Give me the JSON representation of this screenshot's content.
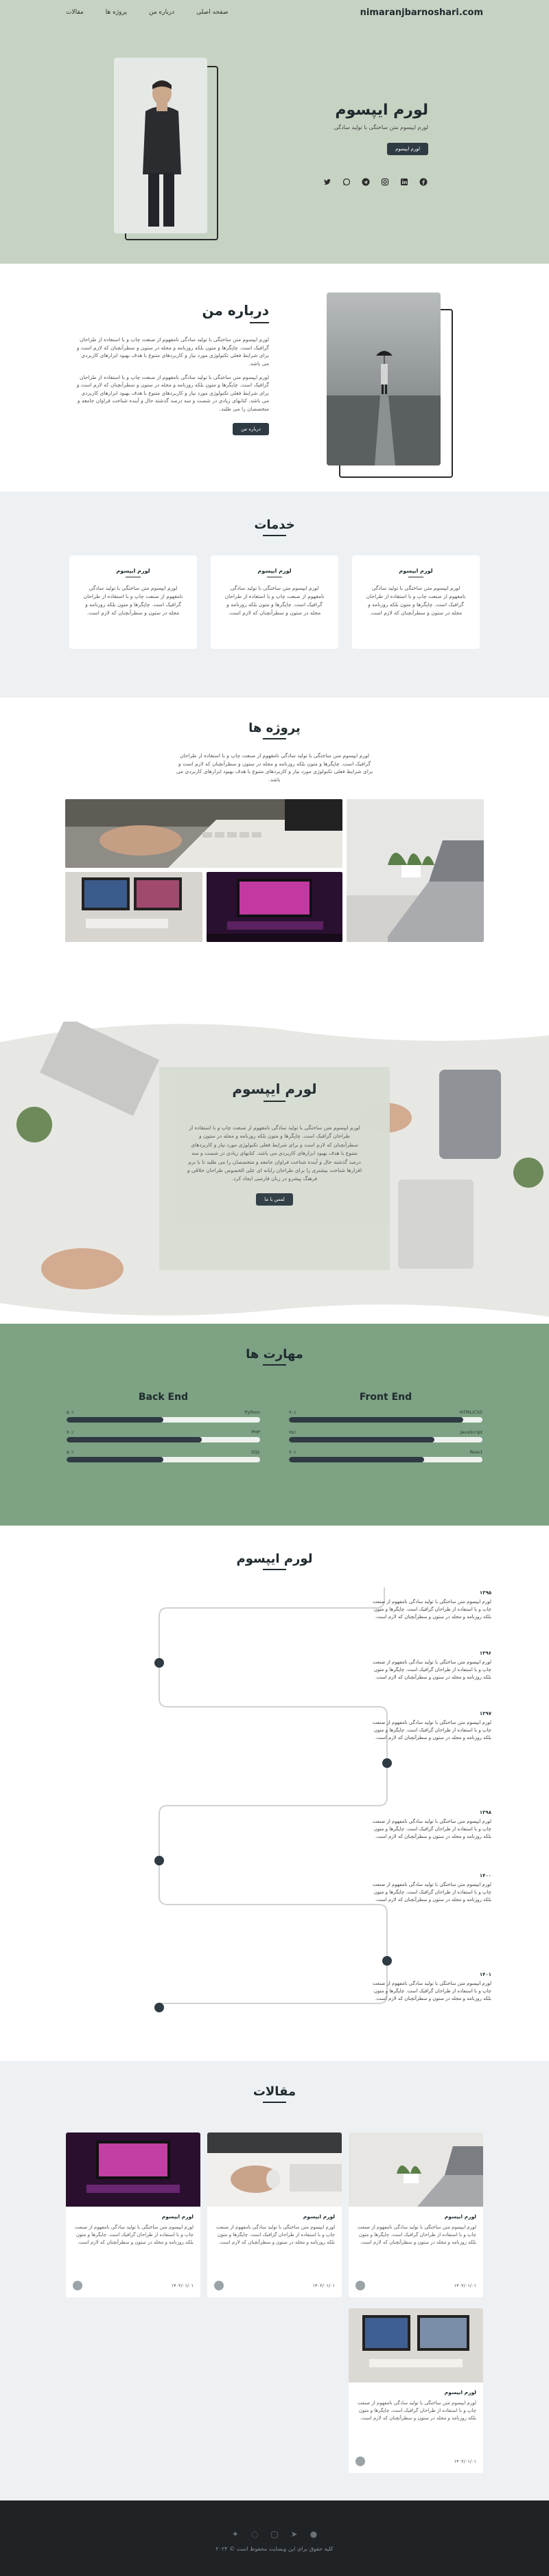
{
  "nav": {
    "brand": "nimaranjbarnoshari.com",
    "links": [
      "صفحه اصلی",
      "درباره من",
      "پروژه ها",
      "مقالات"
    ]
  },
  "hero": {
    "title": "لورم ایپسوم",
    "subtitle": "لورم ایپسوم متن ساختگی با تولید سادگی",
    "button": "لورم ایپسوم",
    "social_icons": [
      "twitter-icon",
      "whatsapp-icon",
      "telegram-icon",
      "instagram-icon",
      "linkedin-icon",
      "facebook-icon"
    ]
  },
  "about": {
    "title": "درباره من",
    "p1": "لورم ایپسوم متن ساختگی با تولید سادگی نامفهوم از صنعت چاپ و با استفاده از طراحان گرافیک است. چاپگرها و متون بلکه روزنامه و مجله در ستون و سطرآنچنان که لازم است و برای شرایط فعلی تکنولوژی مورد نیاز و کاربردهای متنوع با هدف بهبود ابزارهای کاربردی می باشد.",
    "p2": "لورم ایپسوم متن ساختگی با تولید سادگی نامفهوم از صنعت چاپ و با استفاده از طراحان گرافیک است. چاپگرها و متون بلکه روزنامه و مجله در ستون و سطرآنچنان که لازم است و برای شرایط فعلی تکنولوژی مورد نیاز و کاربردهای متنوع با هدف بهبود ابزارهای کاربردی می باشد. کتابهای زیادی در شصت و سه درصد گذشته حال و آینده شناخت فراوان جامعه و متخصصان را می طلبد.",
    "button": "درباره من"
  },
  "services": {
    "title": "خدمات",
    "cards": [
      {
        "title": "لورم ایپسوم",
        "text": "لورم ایپسوم متن ساختگی با تولید سادگی نامفهوم از صنعت چاپ و با استفاده از طراحان گرافیک است. چاپگرها و متون بلکه روزنامه و مجله در ستون و سطرآنچنان که لازم است."
      },
      {
        "title": "لورم ایپسوم",
        "text": "لورم ایپسوم متن ساختگی با تولید سادگی نامفهوم از صنعت چاپ و با استفاده از طراحان گرافیک است. چاپگرها و متون بلکه روزنامه و مجله در ستون و سطرآنچنان که لازم است."
      },
      {
        "title": "لورم ایپسوم",
        "text": "لورم ایپسوم متن ساختگی با تولید سادگی نامفهوم از صنعت چاپ و با استفاده از طراحان گرافیک است. چاپگرها و متون بلکه روزنامه و مجله در ستون و سطرآنچنان که لازم است."
      }
    ]
  },
  "projects": {
    "title": "پروژه ها",
    "desc": "لورم ایپسوم متن ساختگی با تولید سادگی نامفهوم از صنعت چاپ و با استفاده از طراحان گرافیک است. چاپگرها و متون بلکه روزنامه و مجله در ستون و سطرآنچنان که لازم است و برای شرایط فعلی تکنولوژی مورد نیاز و کاربردهای متنوع با هدف بهبود ابزارهای کاربردی می باشد."
  },
  "feature": {
    "title": "لورم ایپسوم",
    "text": "لورم ایپسوم متن ساختگی با تولید سادگی نامفهوم از صنعت چاپ و با استفاده از طراحان گرافیک است. چاپگرها و متون بلکه روزنامه و مجله در ستون و سطرآنچنان که لازم است و برای شرایط فعلی تکنولوژی مورد نیاز و کاربردهای متنوع با هدف بهبود ابزارهای کاربردی می باشد. کتابهای زیادی در شصت و سه درصد گذشته حال و آینده شناخت فراوان جامعه و متخصصان را می طلبد تا با نرم افزارها شناخت بیشتری را برای طراحان رایانه ای علی الخصوص طراحان خلاقی و فرهنگ پیشرو در زبان فارسی ایجاد کرد.",
    "button": "لمس با ما"
  },
  "skills": {
    "title": "مهارت ها",
    "columns": [
      {
        "heading": "Front End",
        "rows": [
          {
            "name": "HTML/CSS",
            "pct_label": "۹۰٪",
            "value": 90
          },
          {
            "name": "JavaScript",
            "pct_label": "۷۵٪",
            "value": 75
          },
          {
            "name": "React",
            "pct_label": "۷۰٪",
            "value": 70
          }
        ]
      },
      {
        "heading": "Back End",
        "rows": [
          {
            "name": "Python",
            "pct_label": "۵۰٪",
            "value": 50
          },
          {
            "name": "PHP",
            "pct_label": "۷۰٪",
            "value": 70
          },
          {
            "name": "SQL",
            "pct_label": "۵۰٪",
            "value": 50
          }
        ]
      }
    ]
  },
  "timeline": {
    "title": "لورم ایپسوم",
    "items": [
      {
        "year": "۱۳۹۵",
        "text": "لورم ایپسوم متن ساختگی با تولید سادگی نامفهوم از صنعت چاپ و با استفاده از طراحان گرافیک است. چاپگرها و متون بلکه روزنامه و مجله در ستون و سطرآنچنان که لازم است."
      },
      {
        "year": "۱۳۹۶",
        "text": "لورم ایپسوم متن ساختگی با تولید سادگی نامفهوم از صنعت چاپ و با استفاده از طراحان گرافیک است. چاپگرها و متون بلکه روزنامه و مجله در ستون و سطرآنچنان که لازم است."
      },
      {
        "year": "۱۳۹۷",
        "text": "لورم ایپسوم متن ساختگی با تولید سادگی نامفهوم از صنعت چاپ و با استفاده از طراحان گرافیک است. چاپگرها و متون بلکه روزنامه و مجله در ستون و سطرآنچنان که لازم است."
      },
      {
        "year": "۱۳۹۸",
        "text": "لورم ایپسوم متن ساختگی با تولید سادگی نامفهوم از صنعت چاپ و با استفاده از طراحان گرافیک است. چاپگرها و متون بلکه روزنامه و مجله در ستون و سطرآنچنان که لازم است."
      },
      {
        "year": "۱۴۰۰",
        "text": "لورم ایپسوم متن ساختگی با تولید سادگی نامفهوم از صنعت چاپ و با استفاده از طراحان گرافیک است. چاپگرها و متون بلکه روزنامه و مجله در ستون و سطرآنچنان که لازم است."
      },
      {
        "year": "۱۴۰۱",
        "text": "لورم ایپسوم متن ساختگی با تولید سادگی نامفهوم از صنعت چاپ و با استفاده از طراحان گرافیک است. چاپگرها و متون بلکه روزنامه و مجله در ستون و سطرآنچنان که لازم است."
      }
    ]
  },
  "articles": {
    "title": "مقالات",
    "items": [
      {
        "title": "لورم ایپسوم",
        "text": "لورم ایپسوم متن ساختگی با تولید سادگی نامفهوم از صنعت چاپ و با استفاده از طراحان گرافیک است. چاپگرها و متون بلکه روزنامه و مجله در ستون و سطرآنچنان که لازم است.",
        "date": "۱۴۰۲/۰۱/۰۱",
        "image": "desk-laptop-plant"
      },
      {
        "title": "لورم ایپسوم",
        "text": "لورم ایپسوم متن ساختگی با تولید سادگی نامفهوم از صنعت چاپ و با استفاده از طراحان گرافیک است. چاپگرها و متون بلکه روزنامه و مجله در ستون و سطرآنچنان که لازم است.",
        "date": "۱۴۰۲/۰۱/۰۱",
        "image": "hand-mouse"
      },
      {
        "title": "لورم ایپسوم",
        "text": "لورم ایپسوم متن ساختگی با تولید سادگی نامفهوم از صنعت چاپ و با استفاده از طراحان گرافیک است. چاپگرها و متون بلکه روزنامه و مجله در ستون و سطرآنچنان که لازم است.",
        "date": "۱۴۰۲/۰۱/۰۱",
        "image": "pink-gaming-setup"
      },
      {
        "title": "لورم ایپسوم",
        "text": "لورم ایپسوم متن ساختگی با تولید سادگی نامفهوم از صنعت چاپ و با استفاده از طراحان گرافیک است. چاپگرها و متون بلکه روزنامه و مجله در ستون و سطرآنچنان که لازم است.",
        "date": "۱۴۰۲/۰۱/۰۱",
        "image": "monitors-desk"
      }
    ]
  },
  "footer": {
    "social_icons": [
      "twitter-icon",
      "whatsapp-icon",
      "instagram-icon",
      "telegram-icon",
      "facebook-icon"
    ],
    "copyright": "کلیه حقوق برای این وبسایت محفوظ است © ۲۰۲۴"
  },
  "colors": {
    "hero_bg": "#c6d2c2",
    "skills_bg": "#7da284",
    "accent_dark": "#2f3b42",
    "footer_bg": "#202326"
  }
}
